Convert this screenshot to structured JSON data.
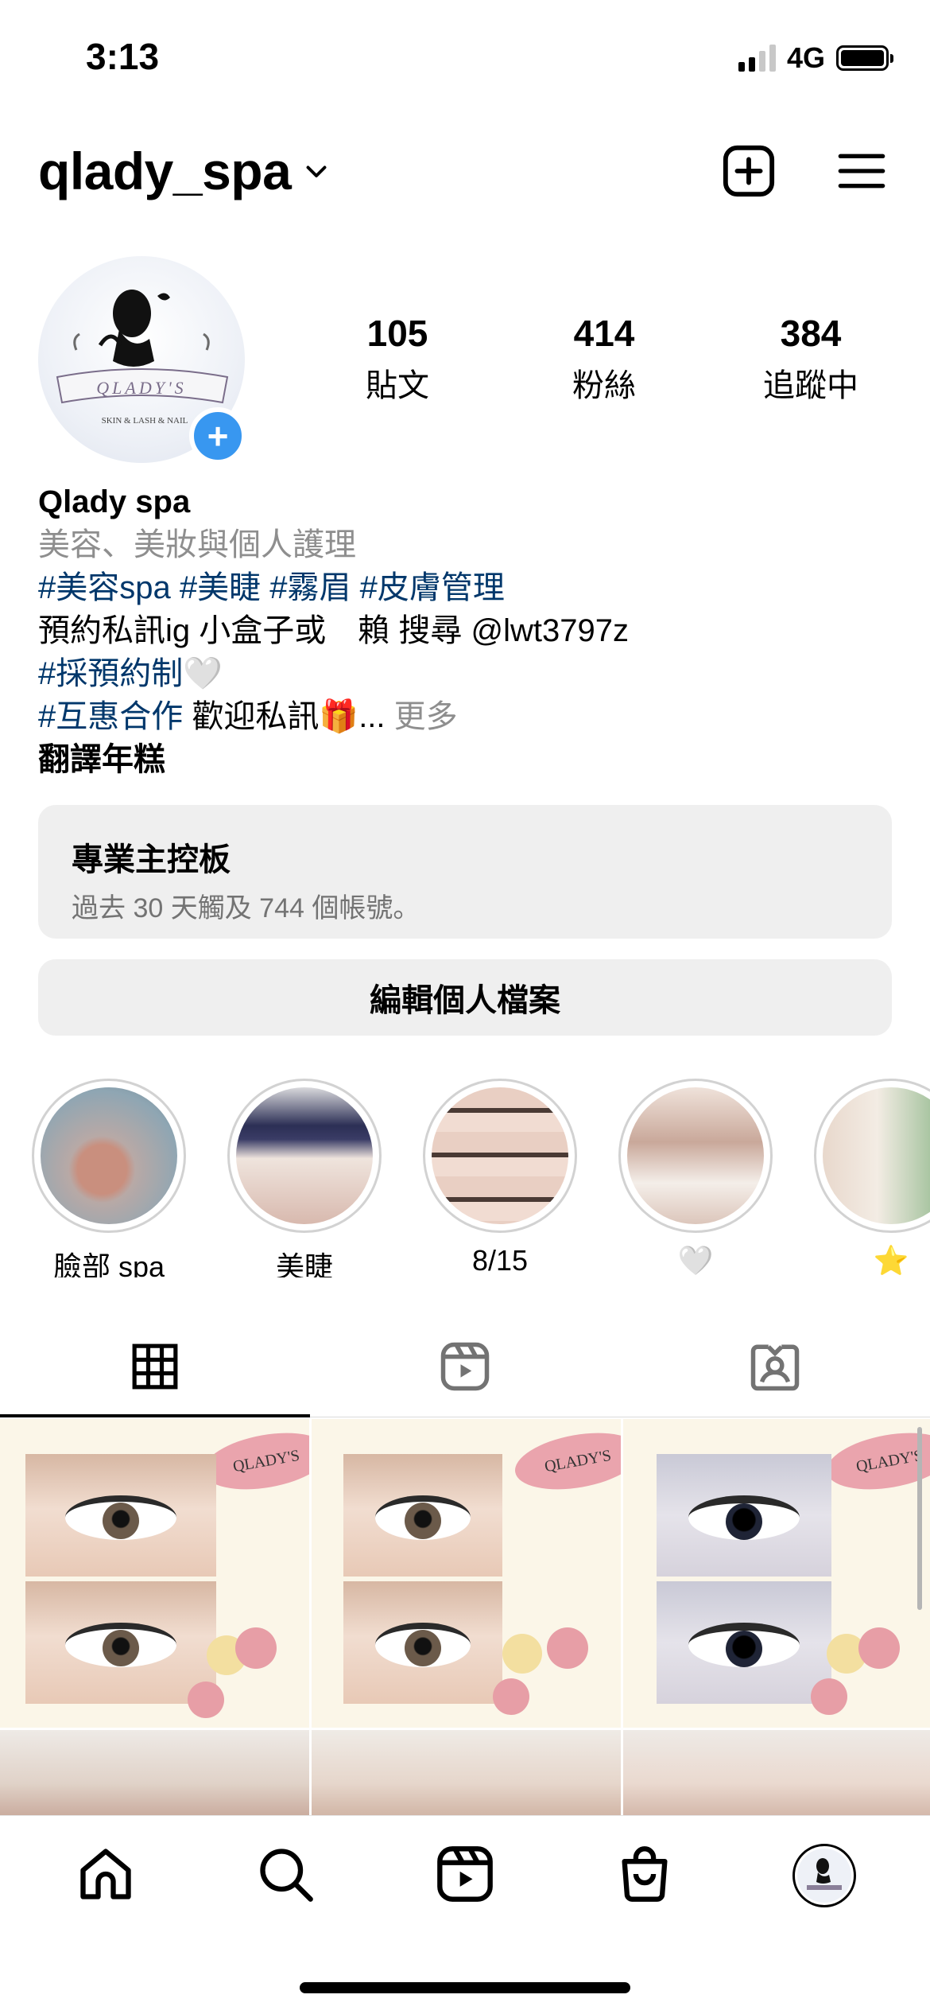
{
  "status_bar": {
    "time": "3:13",
    "network": "4G"
  },
  "header": {
    "username": "qlady_spa"
  },
  "profile": {
    "stats": [
      {
        "num": "105",
        "label": "貼文"
      },
      {
        "num": "414",
        "label": "粉絲"
      },
      {
        "num": "384",
        "label": "追蹤中"
      }
    ],
    "avatar_logo_text": "QLADY'S",
    "avatar_logo_sub": "SKIN & LASH & NAIL"
  },
  "bio": {
    "name": "Qlady spa",
    "category": "美容、美妝與個人護理",
    "tags_line": [
      "#美容spa",
      "#美睫",
      "#霧眉",
      "#皮膚管理"
    ],
    "line3": "預約私訊ig 小盒子或　賴 搜尋 @lwt3797z",
    "line4_tag": "#採預約制",
    "line4_emoji": "🤍",
    "line5_tag": "#互惠合作",
    "line5_text": " 歡迎私訊",
    "line5_emoji": "🎁",
    "ellipsis": "... ",
    "more": "更多",
    "translate": "翻譯年糕"
  },
  "dashboard": {
    "title": "專業主控板",
    "subtitle": "過去 30 天觸及 744 個帳號。"
  },
  "edit_profile": "編輯個人檔案",
  "highlights": [
    {
      "label": "臉部 spa"
    },
    {
      "label": "美睫"
    },
    {
      "label": "8/15"
    },
    {
      "label": "🤍"
    },
    {
      "label": "⭐"
    }
  ],
  "posts": [
    {
      "logo": "QLADY'S"
    },
    {
      "logo": "QLADY'S"
    },
    {
      "logo": "QLADY'S"
    }
  ],
  "colors": {
    "tag": "#00376b",
    "badge": "#3897f0",
    "button_bg": "#efefef",
    "secondary_text": "#8e8e8e"
  },
  "icons": {
    "header": [
      "chevron-down-icon",
      "new-post-icon",
      "menu-icon"
    ],
    "tabs": [
      "grid-icon",
      "reels-icon",
      "tagged-icon"
    ],
    "nav": [
      "home-icon",
      "search-icon",
      "reels-icon",
      "shop-icon",
      "profile-avatar"
    ]
  }
}
